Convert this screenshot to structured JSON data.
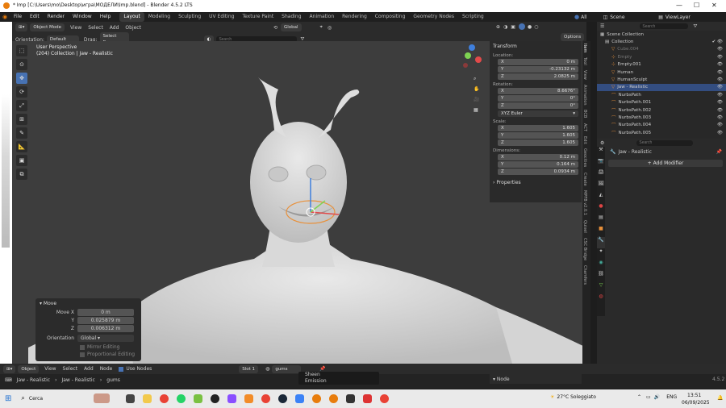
{
  "window": {
    "title": "* Imp [C:\\Users\\mo\\Desktop\\игра\\МОДЕЛИ\\Imp.blend] - Blender 4.5.2 LTS"
  },
  "topbar": {
    "menus": [
      "File",
      "Edit",
      "Render",
      "Window",
      "Help"
    ],
    "workspaces": [
      "Layout",
      "Modeling",
      "Sculpting",
      "UV Editing",
      "Texture Paint",
      "Shading",
      "Animation",
      "Rendering",
      "Compositing",
      "Geometry Nodes",
      "Scripting"
    ],
    "active_workspace": "Layout",
    "scene_label": "Scene",
    "viewlayer_label": "ViewLayer",
    "all_label": "All"
  },
  "viewport_header": {
    "mode": "Object Mode",
    "menus": [
      "View",
      "Select",
      "Add",
      "Object"
    ],
    "orientation_label": "Orientation:",
    "orientation_value": "Default",
    "drag_label": "Drag:",
    "drag_value": "Select Box",
    "transform_space": "Global",
    "search_placeholder": "Search",
    "options_label": "Options"
  },
  "viewport": {
    "view_name": "User Perspective",
    "collection_info": "(204) Collection | Jaw - Realistic"
  },
  "npanel": {
    "header": "Transform",
    "location_label": "Location:",
    "location": [
      {
        "axis": "X",
        "value": "0 m"
      },
      {
        "axis": "Y",
        "value": "-0.23132 m"
      },
      {
        "axis": "Z",
        "value": "2.0825 m"
      }
    ],
    "rotation_label": "Rotation:",
    "rotation": [
      {
        "axis": "X",
        "value": "8.6676°"
      },
      {
        "axis": "Y",
        "value": "0°"
      },
      {
        "axis": "Z",
        "value": "0°"
      }
    ],
    "rotation_mode": "XYZ Euler",
    "scale_label": "Scale:",
    "scale": [
      {
        "axis": "X",
        "value": "1.605"
      },
      {
        "axis": "Y",
        "value": "1.605"
      },
      {
        "axis": "Z",
        "value": "1.605"
      }
    ],
    "dimensions_label": "Dimensions:",
    "dimensions": [
      {
        "axis": "X",
        "value": "0.12 m"
      },
      {
        "axis": "Y",
        "value": "0.164 m"
      },
      {
        "axis": "Z",
        "value": "0.0934 m"
      }
    ],
    "properties_label": "Properties",
    "tabs": [
      "Item",
      "Tool",
      "View",
      "Animation",
      "BCB",
      "ACT",
      "Edit",
      "Geocities",
      "Create",
      "MPFB v2.0.1",
      "Quixel",
      "CSC Bridge",
      "Chamfers"
    ]
  },
  "outliner": {
    "search_placeholder": "Search",
    "root": "Scene Collection",
    "items": [
      {
        "name": "Collection",
        "level": 1,
        "selected": false
      },
      {
        "name": "Cube.004",
        "level": 2,
        "selected": false
      },
      {
        "name": "Empty",
        "level": 2,
        "selected": false
      },
      {
        "name": "Empty.001",
        "level": 2,
        "selected": false
      },
      {
        "name": "Human",
        "level": 2,
        "selected": false
      },
      {
        "name": "HumanSculpt",
        "level": 2,
        "selected": false
      },
      {
        "name": "Jaw - Realistic",
        "level": 2,
        "selected": true
      },
      {
        "name": "NurbsPath",
        "level": 2,
        "selected": false
      },
      {
        "name": "NurbsPath.001",
        "level": 2,
        "selected": false
      },
      {
        "name": "NurbsPath.002",
        "level": 2,
        "selected": false
      },
      {
        "name": "NurbsPath.003",
        "level": 2,
        "selected": false
      },
      {
        "name": "NurbsPath.004",
        "level": 2,
        "selected": false
      },
      {
        "name": "NurbsPath.005",
        "level": 2,
        "selected": false
      }
    ]
  },
  "properties": {
    "search_placeholder": "Search",
    "object_name": "Jaw - Realistic",
    "add_modifier_label": "Add Modifier"
  },
  "move_panel": {
    "title": "Move",
    "fields": [
      {
        "label": "Move X",
        "value": "0 m"
      },
      {
        "label": "Y",
        "value": "0.025879 m"
      },
      {
        "label": "Z",
        "value": "0.006312 m"
      }
    ],
    "orientation_label": "Orientation",
    "orientation_value": "Global",
    "mirror_label": "Mirror Editing",
    "proportional_label": "Proportional Editing"
  },
  "node_header": {
    "mode": "Object",
    "menus": [
      "View",
      "Select",
      "Add",
      "Node"
    ],
    "use_nodes_label": "Use Nodes",
    "slot_label": "Slot 1",
    "material": "gums",
    "node_panel_label": "Node",
    "dropdown_items": [
      "Sheen",
      "Emission"
    ]
  },
  "breadcrumb": [
    "Jaw - Realistic",
    "Jaw - Realistic",
    "gums"
  ],
  "version_label": "4.5.2",
  "taskbar": {
    "search_label": "Cerca",
    "weather": "27°C  Soleggiato",
    "lang": "ENG",
    "time": "13:51",
    "date": "06/09/2025"
  },
  "colors": {
    "accent": "#4772b3",
    "selected_row": "#334d80",
    "viewport_bg": "#3d3d3d",
    "model_color": "#dcdcdc"
  }
}
